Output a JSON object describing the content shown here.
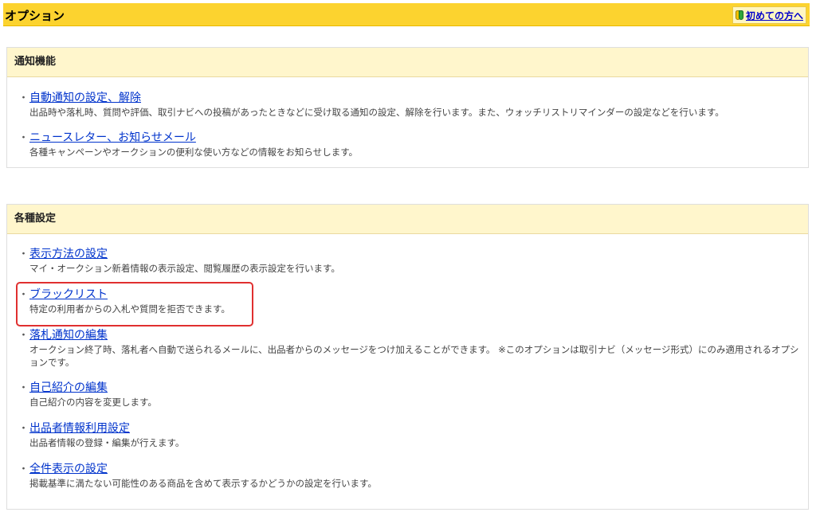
{
  "header": {
    "title": "オプション",
    "beginner_link": "初めての方へ"
  },
  "sections": {
    "notifications": {
      "title": "通知機能",
      "items": [
        {
          "label": "自動通知の設定、解除",
          "desc": "出品時や落札時、質問や評価、取引ナビへの投稿があったときなどに受け取る通知の設定、解除を行います。また、ウォッチリストリマインダーの設定などを行います。"
        },
        {
          "label": "ニュースレター、お知らせメール",
          "desc": "各種キャンペーンやオークションの便利な使い方などの情報をお知らせします。"
        }
      ]
    },
    "settings": {
      "title": "各種設定",
      "items": [
        {
          "label": "表示方法の設定",
          "desc": "マイ・オークション新着情報の表示設定、閲覧履歴の表示設定を行います。"
        },
        {
          "label": "ブラックリスト",
          "desc": "特定の利用者からの入札や質問を拒否できます。"
        },
        {
          "label": "落札通知の編集",
          "desc": "オークション終了時、落札者へ自動で送られるメールに、出品者からのメッセージをつけ加えることができます。 ※このオプションは取引ナビ（メッセージ形式）にのみ適用されるオプションです。"
        },
        {
          "label": "自己紹介の編集",
          "desc": "自己紹介の内容を変更します。"
        },
        {
          "label": "出品者情報利用設定",
          "desc": "出品者情報の登録・編集が行えます。"
        },
        {
          "label": "全件表示の設定",
          "desc": "掲載基準に満たない可能性のある商品を含めて表示するかどうかの設定を行います。"
        }
      ]
    }
  },
  "bullet": "・",
  "colors": {
    "header_bg": "#fcd32f",
    "section_head_bg": "#fff6cc",
    "link": "#0033cc",
    "highlight": "#e03030"
  }
}
